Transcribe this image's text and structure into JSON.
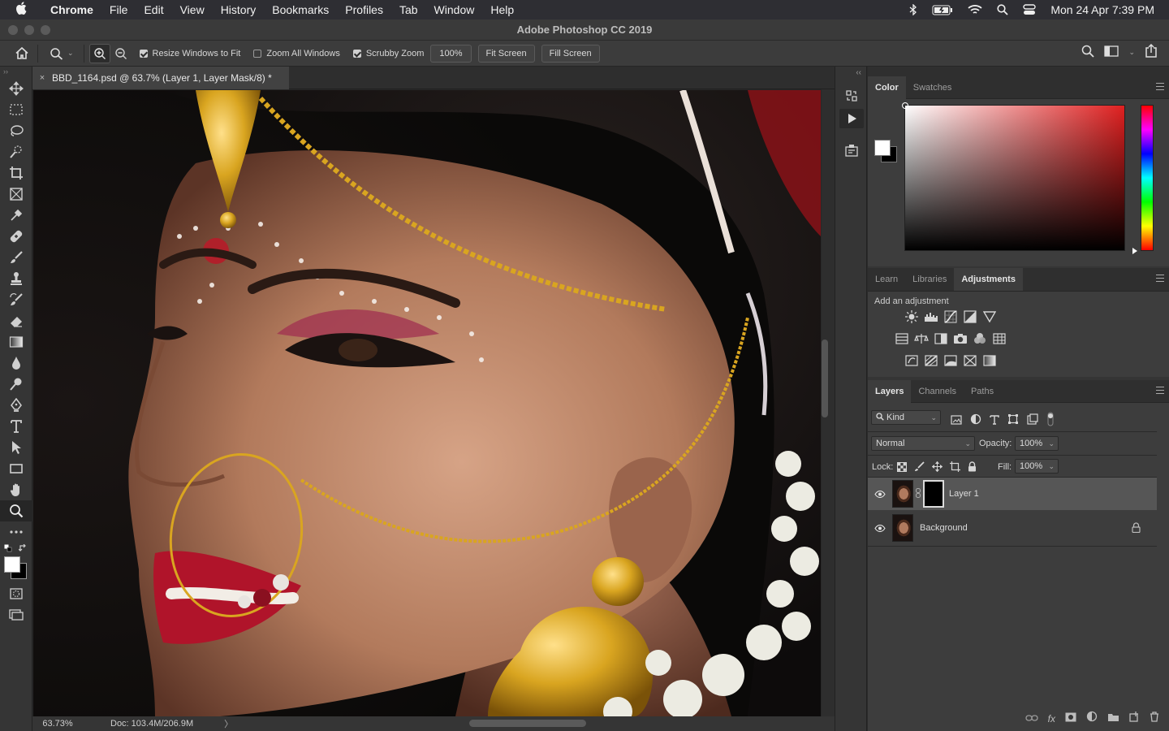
{
  "menubar": {
    "items": [
      "Chrome",
      "File",
      "Edit",
      "View",
      "History",
      "Bookmarks",
      "Profiles",
      "Tab",
      "Window",
      "Help"
    ],
    "clock": "Mon 24 Apr  7:39 PM"
  },
  "window": {
    "title": "Adobe Photoshop CC 2019"
  },
  "options": {
    "resize_windows": "Resize Windows to Fit",
    "zoom_all": "Zoom All Windows",
    "scrubby_zoom": "Scrubby Zoom",
    "zoom_value": "100%",
    "fit_screen": "Fit Screen",
    "fill_screen": "Fill Screen",
    "checked": {
      "resize_windows": true,
      "zoom_all": false,
      "scrubby_zoom": true
    }
  },
  "document": {
    "tab_title": "BBD_1164.psd @ 63.7% (Layer 1, Layer Mask/8) *",
    "close": "×",
    "status_zoom": "63.73%",
    "status_doc": "Doc: 103.4M/206.9M",
    "status_arrow": "〉"
  },
  "panels": {
    "color_tabs": [
      "Color",
      "Swatches"
    ],
    "mid_tabs": [
      "Learn",
      "Libraries",
      "Adjustments"
    ],
    "adjustments_label": "Add an adjustment",
    "layer_tabs": [
      "Layers",
      "Channels",
      "Paths"
    ]
  },
  "layers": {
    "filter_kind": "Kind",
    "blend_mode": "Normal",
    "opacity_label": "Opacity:",
    "opacity_value": "100%",
    "lock_label": "Lock:",
    "fill_label": "Fill:",
    "fill_value": "100%",
    "items": [
      {
        "name": "Layer 1",
        "selected": true
      },
      {
        "name": "Background",
        "locked": true
      }
    ]
  },
  "colors": {
    "foreground": "#ffffff",
    "background": "#000000",
    "accent": "#e02020"
  }
}
